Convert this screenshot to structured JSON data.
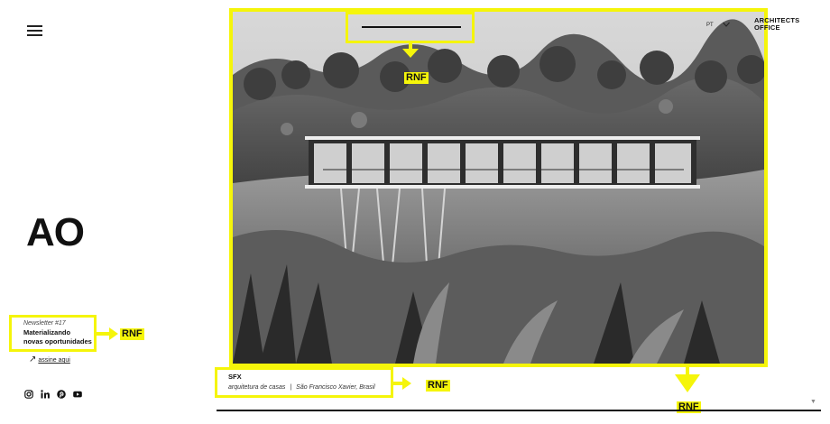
{
  "header": {
    "lang": "PT",
    "brand_line1": "ARCHITECTS",
    "brand_line2": "OFFICE"
  },
  "sidebar": {
    "logo": "AO",
    "newsletter_kicker": "Newsletter #17",
    "newsletter_title_1": "Materializando",
    "newsletter_title_2": "novas oportunidades",
    "subscribe_label": "assine aqui"
  },
  "project": {
    "code": "SFX",
    "type": "arquitetura de casas",
    "separator": "|",
    "location": "São Francisco Xavier, Brasil"
  },
  "annotations": {
    "label": "RNF",
    "color": "#f5f50a"
  },
  "icons": [
    "menu-icon",
    "chevron-down-icon",
    "arrow-up-right-icon",
    "instagram-icon",
    "linkedin-icon",
    "pinterest-icon",
    "youtube-icon"
  ]
}
